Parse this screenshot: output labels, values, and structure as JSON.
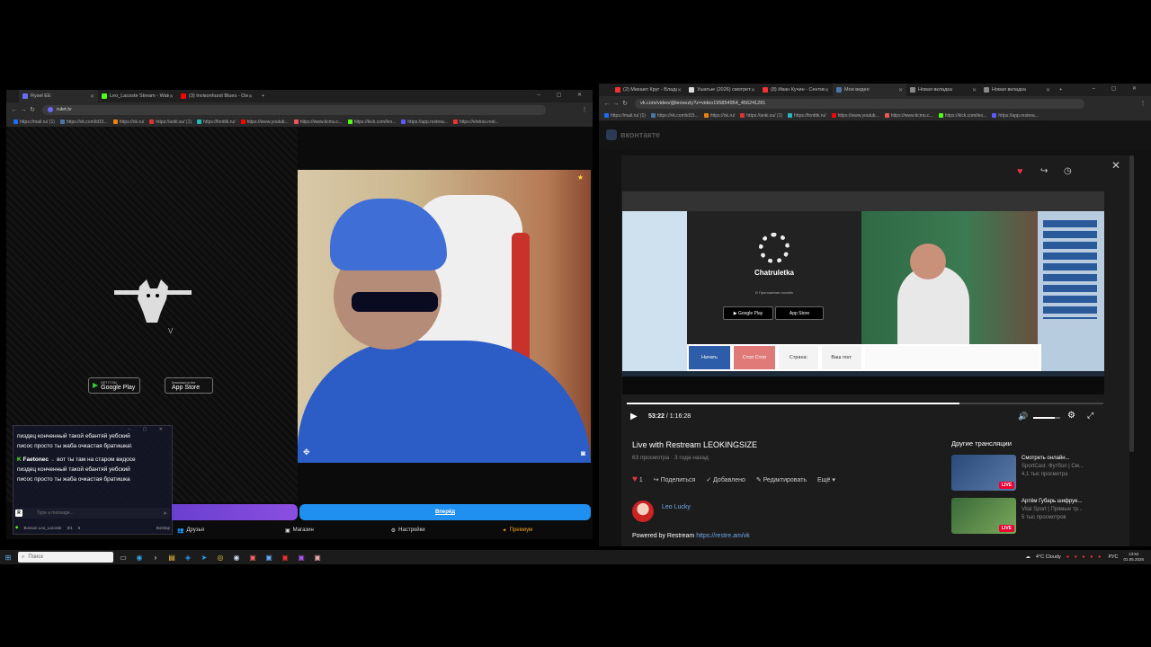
{
  "left_browser": {
    "tabs": [
      {
        "label": "Rysel EE",
        "color": "#6b6bff"
      },
      {
        "label": "Leo_Lacoste Stream - Watch Li",
        "color": "#53fc18"
      },
      {
        "label": "(3) Invisonhurst Blues - Oscar I",
        "color": "#ff0000"
      }
    ],
    "address": "rulet.tv",
    "bookmarks": [
      {
        "label": "https://mail.ru/ (1)",
        "color": "#1e6bff"
      },
      {
        "label": "https://vk.com/id15...",
        "color": "#4a76a8"
      },
      {
        "label": "https://ok.ru/",
        "color": "#ee8208"
      },
      {
        "label": "https://anki.su/ (1)",
        "color": "#d33"
      },
      {
        "label": "https://fonttik.ru/",
        "color": "#2bb"
      },
      {
        "label": "https://www.youtub...",
        "color": "#f00"
      },
      {
        "label": "https://www.ticmu.c...",
        "color": "#e55"
      },
      {
        "label": "https://kick.com/leo...",
        "color": "#53fc18"
      },
      {
        "label": "https://app.restrea...",
        "color": "#5a5aff"
      },
      {
        "label": "https://elotrso.rest...",
        "color": "#e33"
      }
    ]
  },
  "roulette": {
    "logo_letter": "V",
    "google_play": {
      "small": "GET IT ON",
      "big": "Google Play"
    },
    "app_store": {
      "small": "Download on the",
      "big": "App Store"
    },
    "chat": [
      {
        "text": "пиздец конченный такой ебантяй уебский"
      },
      {
        "text": "писос просто ты жаба очкастая братишка\\"
      },
      {
        "user": "Faetonec",
        "text": "вот ты там на старом видосе"
      },
      {
        "text": "пиздец конченный такой ебантяй уебский"
      },
      {
        "text": "писос просто ты жаба очкастая братишка"
      }
    ],
    "chat_input_placeholder": "Type a message...",
    "chat_footer": {
      "name": "Bosson Leo_Lacoste",
      "count1": "0/1",
      "count2": "5",
      "status": "Bosttop"
    },
    "next_label": "Вперёд",
    "bottom_nav": [
      "Друзья",
      "Магазин",
      "Настройки",
      "Премиум"
    ]
  },
  "right_browser": {
    "tabs": [
      {
        "label": "(2) Михаил Круг - Владими",
        "color": "#e33"
      },
      {
        "label": "Ушатые (2026) смотреть о",
        "color": "#ddd"
      },
      {
        "label": "(8) Иван Кучин - Сентим",
        "color": "#e33"
      },
      {
        "label": "Мои видео",
        "color": "#4a76a8"
      },
      {
        "label": "Новая вкладка",
        "color": "#888"
      },
      {
        "label": "Новая вкладка",
        "color": "#888"
      }
    ],
    "address": "vk.com/video/@leovezly?z=video195854954_456241281",
    "bookmarks": [
      {
        "label": "https://mail.ru/ (1)",
        "color": "#1e6bff"
      },
      {
        "label": "https://vk.com/id15...",
        "color": "#4a76a8"
      },
      {
        "label": "https://ok.ru/",
        "color": "#ee8208"
      },
      {
        "label": "https://anki.su/ (1)",
        "color": "#d33"
      },
      {
        "label": "https://fonttik.ru/",
        "color": "#2bb"
      },
      {
        "label": "https://www.youtub...",
        "color": "#f00"
      },
      {
        "label": "https://www.ticmu.c...",
        "color": "#e55"
      },
      {
        "label": "https://kick.com/leo...",
        "color": "#53fc18"
      },
      {
        "label": "https://app.restrea...",
        "color": "#5a5aff"
      }
    ]
  },
  "vk": {
    "logo": "вконтакте",
    "nested_app": "Chatruletka",
    "nested_subtitle": "В Приложении онлайн",
    "nested_buttons": [
      "Начать",
      "Стоп Стоп",
      "Страна:",
      "Ваш пол:"
    ],
    "time_current": "53:22",
    "time_total": "1:16:28",
    "progress": 0.698,
    "volume": 0.8,
    "video_title": "Live with Restream LEOKINGSIZE",
    "views": "63 просмотра",
    "ago": "3 года назад",
    "likes": "1",
    "actions": {
      "share": "Поделиться",
      "added": "Добавлено",
      "edit": "Редактировать",
      "more": "Ещё"
    },
    "author": "Leo Lucky",
    "powered_label": "Powered by Restream",
    "powered_link": "https://restre.am/vk",
    "other_header": "Другие трансляции",
    "other_streams": [
      {
        "title": "Смотреть онлайн...",
        "channel": "SportCast. Футбол | См...",
        "views": "4,1 тыс просмотра",
        "badge": "LIVE"
      },
      {
        "title": "Артём Губарь шифруе...",
        "channel": "Vital Sport | Прямые тр...",
        "views": "5 тыс просмотров",
        "badge": "LIVE"
      }
    ]
  },
  "taskbar": {
    "search_placeholder": "Поиск",
    "weather": "4°C Cloudy",
    "lang": "РУС",
    "time": "13:52",
    "date": "01.05.2026"
  }
}
